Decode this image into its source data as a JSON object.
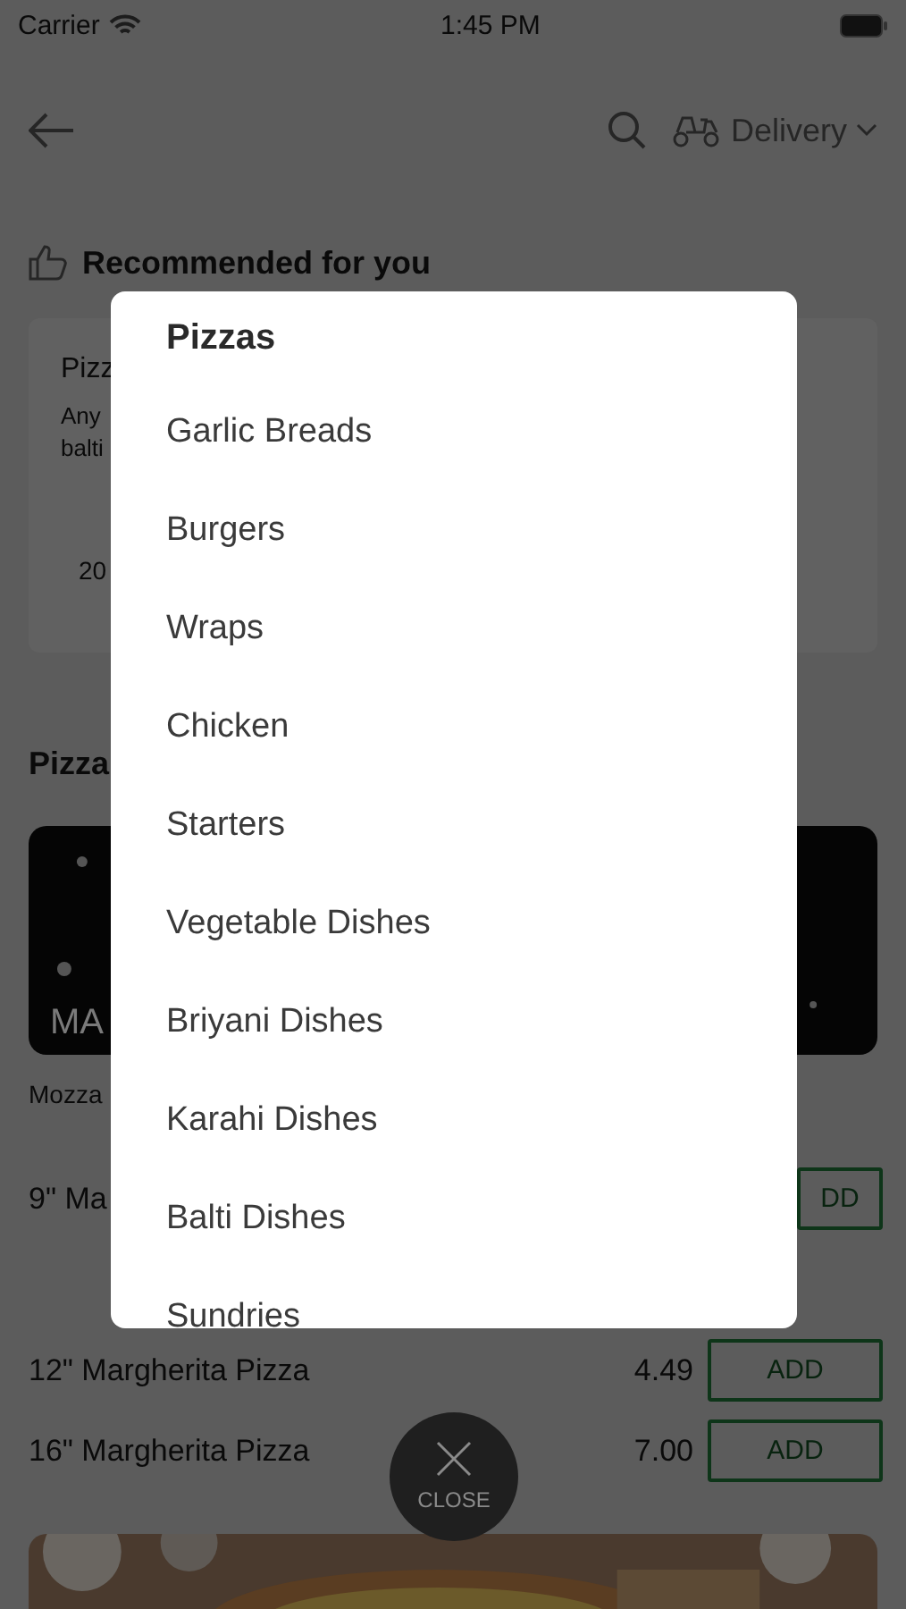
{
  "status_bar": {
    "carrier": "Carrier",
    "time": "1:45 PM"
  },
  "header": {
    "delivery_mode": "Delivery"
  },
  "recommended": {
    "title": "Recommended for you",
    "card": {
      "name": "Pizz",
      "description": [
        "Any",
        "balti"
      ],
      "price": "20"
    }
  },
  "section": {
    "title": "Pizza",
    "banner": {
      "kind": "picture",
      "label": "MA"
    },
    "subtitle": "Mozza"
  },
  "items": [
    {
      "kind": "partial",
      "name": "9\" Ma",
      "button": "DD"
    },
    {
      "kind": "full",
      "name": "12\" Margherita Pizza",
      "price": "4.49",
      "button": "ADD"
    },
    {
      "kind": "full",
      "name": "16\" Margherita Pizza",
      "price": "7.00",
      "button": "ADD"
    }
  ],
  "category_menu": {
    "title": "Pizzas",
    "items": [
      "Garlic Breads",
      "Burgers",
      "Wraps",
      "Chicken",
      "Starters",
      "Vegetable Dishes",
      "Briyani Dishes",
      "Karahi Dishes",
      "Balti Dishes",
      "Sundries"
    ]
  },
  "close_button": {
    "label": "CLOSE"
  }
}
